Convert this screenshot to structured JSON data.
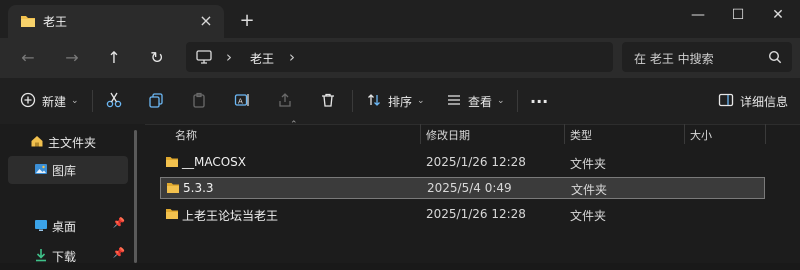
{
  "tab": {
    "title": "老王",
    "close": "×"
  },
  "new_tab": "+",
  "window_controls": {
    "minimize": "—",
    "maximize": "☐",
    "close": "✕"
  },
  "nav": {
    "back": "←",
    "forward": "→",
    "up": "↑",
    "refresh": "↻"
  },
  "address": {
    "crumb": "老王",
    "sep": "›"
  },
  "search": {
    "placeholder": "在 老王 中搜索"
  },
  "toolbar": {
    "new_label": "新建",
    "sort_label": "排序",
    "view_label": "查看",
    "more": "···",
    "details_label": "详细信息"
  },
  "sidebar": {
    "items": [
      {
        "label": "主文件夹"
      },
      {
        "label": "图库"
      },
      {
        "label": "桌面"
      },
      {
        "label": "下载"
      }
    ]
  },
  "columns": {
    "name": "名称",
    "date": "修改日期",
    "type": "类型",
    "size": "大小"
  },
  "files": [
    {
      "name": "__MACOSX",
      "date": "2025/1/26 12:28",
      "type": "文件夹"
    },
    {
      "name": "5.3.3",
      "date": "2025/5/4 0:49",
      "type": "文件夹"
    },
    {
      "name": "上老王论坛当老王",
      "date": "2025/1/26 12:28",
      "type": "文件夹"
    }
  ],
  "colors": {
    "folder": "#f2c14e",
    "accent": "#6cb8f5"
  }
}
